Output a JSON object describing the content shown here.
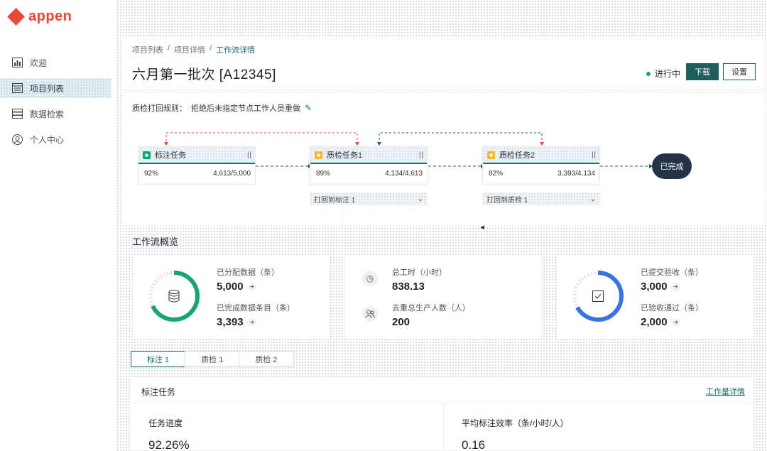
{
  "app": {
    "logo": "appen"
  },
  "sidebar": {
    "items": [
      {
        "label": "欢迎",
        "icon": "chart-icon"
      },
      {
        "label": "项目列表",
        "icon": "list-icon"
      },
      {
        "label": "数据检索",
        "icon": "database-icon"
      },
      {
        "label": "个人中心",
        "icon": "user-icon"
      }
    ]
  },
  "header": {
    "breadcrumbs": [
      "项目列表",
      "项目详情",
      "工作流详情"
    ],
    "title": "六月第一批次 [A12345]",
    "status": "进行中",
    "download_label": "下载",
    "settings_label": "设置"
  },
  "flow": {
    "rule_label": "质检打回规则：",
    "rule_text": "拒绝后未指定节点工作人员重做",
    "nodes": [
      {
        "name": "标注任务",
        "percent": "92%",
        "progress": "4,613/5,000"
      },
      {
        "name": "质检任务1",
        "percent": "89%",
        "progress": "4,134/4,613",
        "sub": "打回到标注 1"
      },
      {
        "name": "质检任务2",
        "percent": "82%",
        "progress": "3,393/4,134",
        "sub": "打回到质检 1"
      }
    ],
    "done_label": "已完成"
  },
  "overview": {
    "title": "工作流概览",
    "card1": {
      "assigned_label": "已分配数据（条）",
      "assigned_value": "5,000",
      "completed_label": "已完成数据条目（条）",
      "completed_value": "3,393",
      "ring_fraction": 0.68,
      "ring_color": "#17a673"
    },
    "card2": {
      "hours_label": "总工时（小时）",
      "hours_value": "838.13",
      "workers_label": "去重总生产人数（人）",
      "workers_value": "200"
    },
    "card3": {
      "submitted_label": "已提交验收（条）",
      "submitted_value": "3,000",
      "accepted_label": "已验收通过（条）",
      "accepted_value": "2,000",
      "ring_fraction": 0.67,
      "ring_color": "#3b73e6"
    }
  },
  "tabs": [
    "标注 1",
    "质检 1",
    "质检 2"
  ],
  "panel": {
    "title": "标注任务",
    "link": "工作量详情",
    "progress_label": "任务进度",
    "progress_value": "92.26%",
    "efficiency_label": "平均标注效率（条/小时/人）",
    "efficiency_value": "0.16"
  }
}
